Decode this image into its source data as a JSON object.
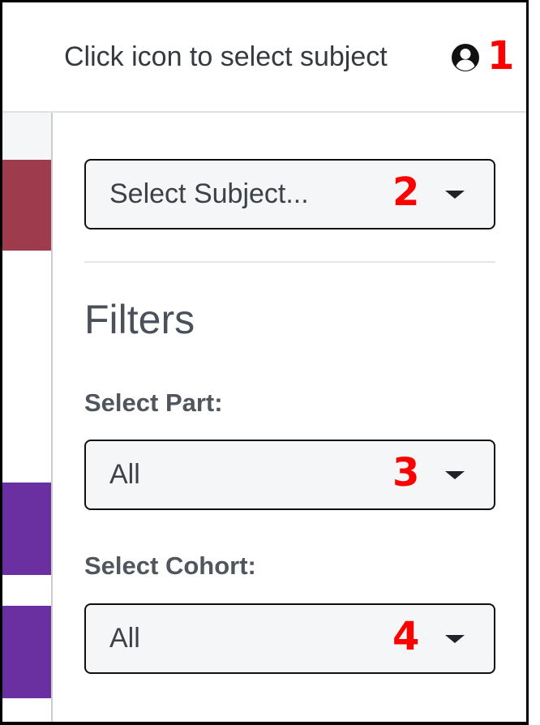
{
  "header": {
    "instruction": "Click icon to select subject",
    "icon": "user-circle-icon",
    "marker": "1"
  },
  "subject_select": {
    "value": "Select Subject...",
    "marker": "2"
  },
  "filters": {
    "title": "Filters",
    "part": {
      "label": "Select Part:",
      "value": "All",
      "marker": "3"
    },
    "cohort": {
      "label": "Select Cohort:",
      "value": "All",
      "marker": "4"
    }
  },
  "colors": {
    "marker": "#ff0000",
    "strip_red": "#9e3b4d",
    "strip_purple": "#6a2fa0"
  }
}
